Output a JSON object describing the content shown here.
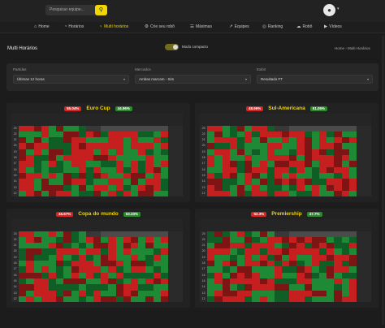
{
  "topbar": {
    "search_placeholder": "Pesquisar equipe...",
    "search_icon": "search-icon",
    "avatar_icon": "user-icon",
    "avatar_caret_icon": "caret-down-icon"
  },
  "nav": {
    "items": [
      {
        "label": "Home",
        "icon": "home-icon",
        "glyph": "⌂",
        "active": false
      },
      {
        "label": "Horários",
        "icon": "clock-icon",
        "glyph": "◔",
        "active": false
      },
      {
        "label": "Multi horários",
        "icon": "bulb-icon",
        "glyph": "♀",
        "active": true
      },
      {
        "label": "Crie seu robô",
        "icon": "gear-icon",
        "glyph": "⚙",
        "active": false
      },
      {
        "label": "Máximas",
        "icon": "list-icon",
        "glyph": "☰",
        "active": false
      },
      {
        "label": "Equipes",
        "icon": "trend-icon",
        "glyph": "↗",
        "active": false
      },
      {
        "label": "Ranking",
        "icon": "target-icon",
        "glyph": "◎",
        "active": false
      },
      {
        "label": "Robô",
        "icon": "robot-icon",
        "glyph": "☁",
        "active": false
      },
      {
        "label": "Vídeos",
        "icon": "play-icon",
        "glyph": "▶",
        "active": false
      }
    ]
  },
  "header": {
    "title": "Multi Horários",
    "toggle_label": "Modo compacto",
    "breadcrumb_home": "Home",
    "breadcrumb_sep": "›",
    "breadcrumb_current": "Multi Horários"
  },
  "filters": [
    {
      "label": "Partidas",
      "value": "Últimas 12 horas"
    },
    {
      "label": "Mercados",
      "value": "Ambas marcam - Sim"
    },
    {
      "label": "Exibir",
      "value": "Resultado FT"
    }
  ],
  "panels": [
    {
      "name": "Euro Cup",
      "pct_red": "55.04%",
      "pct_green": "44.96%",
      "row_labels": [
        "23",
        "22",
        "21",
        "20",
        "19",
        "18",
        "17",
        "16",
        "15",
        "14",
        "13",
        "12"
      ]
    },
    {
      "name": "Sul-Americana",
      "pct_red": "48.96%",
      "pct_green": "51.05%",
      "row_labels": [
        "23",
        "22",
        "21",
        "20",
        "19",
        "18",
        "17",
        "16",
        "15",
        "14",
        "13",
        "12"
      ]
    },
    {
      "name": "Copa do mundo",
      "pct_red": "46.67%",
      "pct_green": "53.33%",
      "row_labels": [
        "23",
        "22",
        "21",
        "20",
        "19",
        "18",
        "17",
        "16",
        "15",
        "14",
        "13",
        "12"
      ]
    },
    {
      "name": "Premiership",
      "pct_red": "52.3%",
      "pct_green": "47.7%",
      "row_labels": [
        "23",
        "22",
        "21",
        "20",
        "19",
        "18",
        "17",
        "16",
        "15",
        "14",
        "13",
        "12"
      ]
    }
  ],
  "colors": {
    "accent": "#f2d600",
    "win": "#1f8a36",
    "loss": "#c61f1f",
    "background": "#1c1c1c"
  }
}
